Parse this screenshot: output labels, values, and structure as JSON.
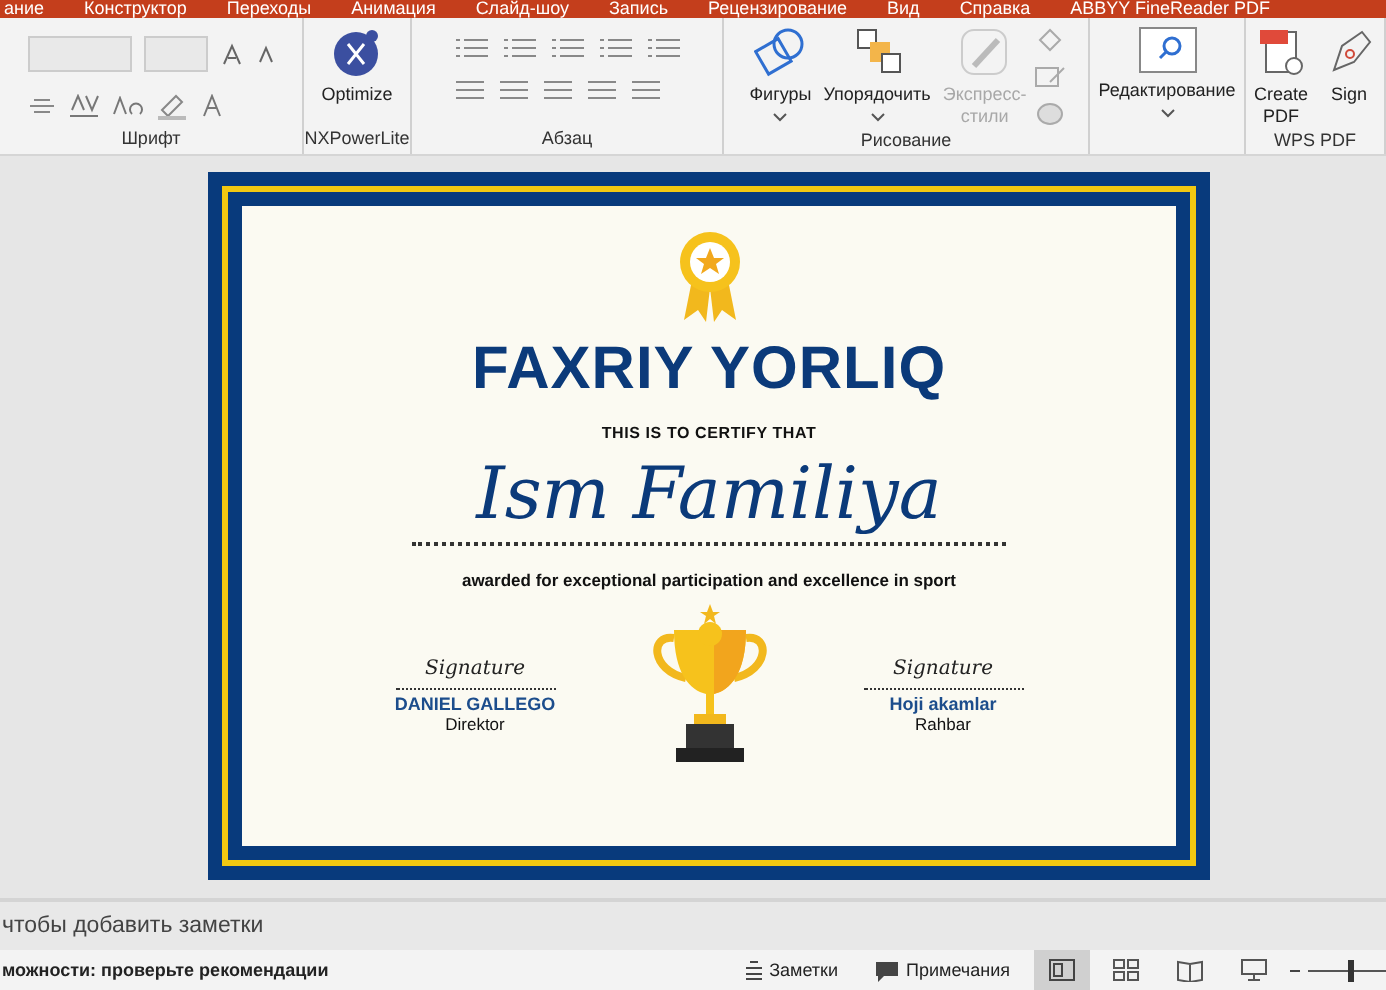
{
  "menu_tabs": [
    {
      "label": "ание"
    },
    {
      "label": "Конструктор"
    },
    {
      "label": "Переходы"
    },
    {
      "label": "Анимация"
    },
    {
      "label": "Слайд-шоу"
    },
    {
      "label": "Запись"
    },
    {
      "label": "Рецензирование"
    },
    {
      "label": "Вид"
    },
    {
      "label": "Справка"
    },
    {
      "label": "ABBYY FineReader PDF"
    }
  ],
  "ribbon": {
    "groups": [
      {
        "label": "Шрифт",
        "kind": "font"
      },
      {
        "label": "NXPowerLite",
        "kind": "nx",
        "buttons": [
          {
            "label": "Optimize",
            "kind": "optimize",
            "disabled": false
          }
        ]
      },
      {
        "label": "Абзац",
        "kind": "paragraph"
      },
      {
        "label": "Рисование",
        "kind": "drawing",
        "buttons": [
          {
            "label": "Фигуры",
            "kind": "shapes",
            "disabled": false
          },
          {
            "label": "Упорядочить",
            "kind": "arrange",
            "disabled": false
          },
          {
            "label": "Экспресс-стили",
            "kind": "styles",
            "disabled": true
          }
        ]
      },
      {
        "kind": "editing",
        "buttons": [
          {
            "label": "Редактирование",
            "kind": "find",
            "disabled": false
          }
        ]
      },
      {
        "label": "WPS PDF",
        "kind": "wps",
        "buttons": [
          {
            "label": "Create PDF",
            "kind": "createpdf",
            "disabled": false
          },
          {
            "label": "Sign",
            "kind": "sign",
            "disabled": false
          }
        ]
      }
    ]
  },
  "slide": {
    "title": "FAXRIY YORLIQ",
    "subtitle": "THIS IS TO CERTIFY THAT",
    "name": "Ism Familiya",
    "description": "awarded for exceptional participation and excellence in sport",
    "signers": [
      {
        "signature": "Signature",
        "name": "DANIEL GALLEGO",
        "role": "Direktor"
      },
      {
        "signature": "Signature",
        "name": "Hoji akamlar",
        "role": "Rahbar"
      }
    ]
  },
  "notes": {
    "placeholder": "чтобы добавить заметки"
  },
  "status_bar": {
    "message": "можности: проверьте рекомендации",
    "buttons": [
      {
        "label": "Заметки",
        "kind": "notes"
      },
      {
        "label": "Примечания",
        "kind": "comments"
      }
    ],
    "views": [
      {
        "kind": "normal",
        "selected": true
      },
      {
        "kind": "sorter",
        "selected": false
      },
      {
        "kind": "reading",
        "selected": false
      },
      {
        "kind": "show",
        "selected": false
      }
    ],
    "zoom": {
      "level": 0.55
    }
  }
}
